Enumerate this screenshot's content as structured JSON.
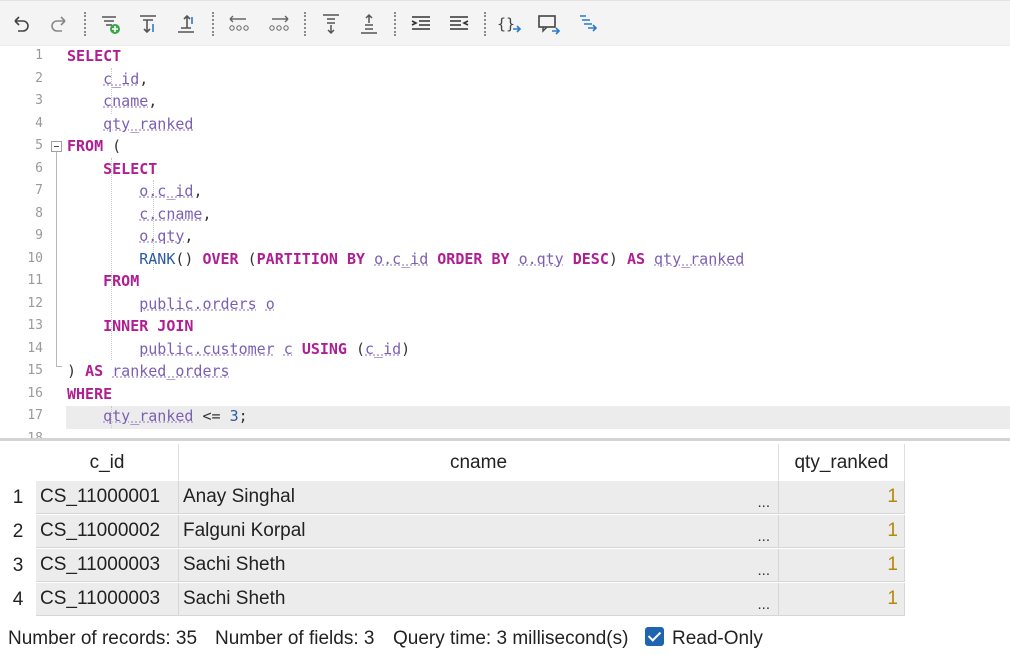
{
  "toolbar": {
    "buttons": [
      {
        "name": "undo-icon"
      },
      {
        "name": "redo-icon"
      },
      {
        "name": "add-filter-icon"
      },
      {
        "name": "sort-descending-icon"
      },
      {
        "name": "sort-ascending-icon"
      },
      {
        "name": "move-left-icon"
      },
      {
        "name": "move-right-icon"
      },
      {
        "name": "align-top-icon"
      },
      {
        "name": "align-bottom-icon"
      },
      {
        "name": "indent-icon"
      },
      {
        "name": "outdent-icon"
      },
      {
        "name": "format-braces-icon"
      },
      {
        "name": "comment-icon"
      },
      {
        "name": "explain-icon"
      }
    ]
  },
  "editor": {
    "line_numbers": [
      "1",
      "2",
      "3",
      "4",
      "5",
      "6",
      "7",
      "8",
      "9",
      "10",
      "11",
      "12",
      "13",
      "14",
      "15",
      "16",
      "17",
      "18"
    ],
    "lines": [
      [
        {
          "t": "SELECT",
          "c": "kw"
        }
      ],
      [
        {
          "t": "    ",
          "c": "pl"
        },
        {
          "t": "c_id",
          "c": "id"
        },
        {
          "t": ",",
          "c": "pl"
        }
      ],
      [
        {
          "t": "    ",
          "c": "pl"
        },
        {
          "t": "cname",
          "c": "id"
        },
        {
          "t": ",",
          "c": "pl"
        }
      ],
      [
        {
          "t": "    ",
          "c": "pl"
        },
        {
          "t": "qty_ranked",
          "c": "id"
        }
      ],
      [
        {
          "t": "FROM",
          "c": "kw"
        },
        {
          "t": " (",
          "c": "pl"
        }
      ],
      [
        {
          "t": "    ",
          "c": "pl"
        },
        {
          "t": "SELECT",
          "c": "kw"
        }
      ],
      [
        {
          "t": "        ",
          "c": "pl"
        },
        {
          "t": "o.c_id",
          "c": "id"
        },
        {
          "t": ",",
          "c": "pl"
        }
      ],
      [
        {
          "t": "        ",
          "c": "pl"
        },
        {
          "t": "c.cname",
          "c": "id"
        },
        {
          "t": ",",
          "c": "pl"
        }
      ],
      [
        {
          "t": "        ",
          "c": "pl"
        },
        {
          "t": "o.qty",
          "c": "id"
        },
        {
          "t": ",",
          "c": "pl"
        }
      ],
      [
        {
          "t": "        ",
          "c": "pl"
        },
        {
          "t": "RANK",
          "c": "fn"
        },
        {
          "t": "() ",
          "c": "pl"
        },
        {
          "t": "OVER",
          "c": "kw"
        },
        {
          "t": " (",
          "c": "pl"
        },
        {
          "t": "PARTITION BY",
          "c": "kw"
        },
        {
          "t": " ",
          "c": "pl"
        },
        {
          "t": "o.c_id",
          "c": "id"
        },
        {
          "t": " ",
          "c": "pl"
        },
        {
          "t": "ORDER BY",
          "c": "kw"
        },
        {
          "t": " ",
          "c": "pl"
        },
        {
          "t": "o.qty",
          "c": "id"
        },
        {
          "t": " ",
          "c": "pl"
        },
        {
          "t": "DESC",
          "c": "kw"
        },
        {
          "t": ") ",
          "c": "pl"
        },
        {
          "t": "AS",
          "c": "kw"
        },
        {
          "t": " ",
          "c": "pl"
        },
        {
          "t": "qty_ranked",
          "c": "id"
        }
      ],
      [
        {
          "t": "    ",
          "c": "pl"
        },
        {
          "t": "FROM",
          "c": "kw"
        }
      ],
      [
        {
          "t": "        ",
          "c": "pl"
        },
        {
          "t": "public.orders",
          "c": "id"
        },
        {
          "t": " ",
          "c": "pl"
        },
        {
          "t": "o",
          "c": "id"
        }
      ],
      [
        {
          "t": "    ",
          "c": "pl"
        },
        {
          "t": "INNER JOIN",
          "c": "kw"
        }
      ],
      [
        {
          "t": "        ",
          "c": "pl"
        },
        {
          "t": "public.customer",
          "c": "id"
        },
        {
          "t": " ",
          "c": "pl"
        },
        {
          "t": "c",
          "c": "id"
        },
        {
          "t": " ",
          "c": "pl"
        },
        {
          "t": "USING",
          "c": "kw"
        },
        {
          "t": " (",
          "c": "pl"
        },
        {
          "t": "c_id",
          "c": "id"
        },
        {
          "t": ")",
          "c": "pl"
        }
      ],
      [
        {
          "t": ") ",
          "c": "pl"
        },
        {
          "t": "AS",
          "c": "kw"
        },
        {
          "t": " ",
          "c": "pl"
        },
        {
          "t": "ranked_orders",
          "c": "id"
        }
      ],
      [
        {
          "t": "WHERE",
          "c": "kw"
        }
      ],
      [
        {
          "t": "    ",
          "c": "pl"
        },
        {
          "t": "qty_ranked",
          "c": "id"
        },
        {
          "t": " <= ",
          "c": "pl"
        },
        {
          "t": "3",
          "c": "num"
        },
        {
          "t": ";",
          "c": "pl"
        }
      ],
      []
    ]
  },
  "grid": {
    "columns": [
      "c_id",
      "cname",
      "qty_ranked"
    ],
    "row_numbers": [
      "1",
      "2",
      "3",
      "4"
    ],
    "rows": [
      [
        "CS_11000001",
        "Anay Singhal",
        "1"
      ],
      [
        "CS_11000002",
        "Falguni Korpal",
        "1"
      ],
      [
        "CS_11000003",
        "Sachi Sheth",
        "1"
      ],
      [
        "CS_11000003",
        "Sachi Sheth",
        "1"
      ]
    ],
    "ellipsis": "..."
  },
  "status": {
    "records": "Number of records: 35",
    "fields": "Number of fields: 3",
    "query_time": "Query time: 3 millisecond(s)",
    "read_only_label": "Read-Only",
    "read_only_checked": true
  },
  "colors": {
    "keyword": "#b01e94",
    "identifier": "#7b5fb3",
    "function": "#2a5aa5",
    "number_cell": "#b8860b",
    "checkbox": "#1f64b0"
  }
}
